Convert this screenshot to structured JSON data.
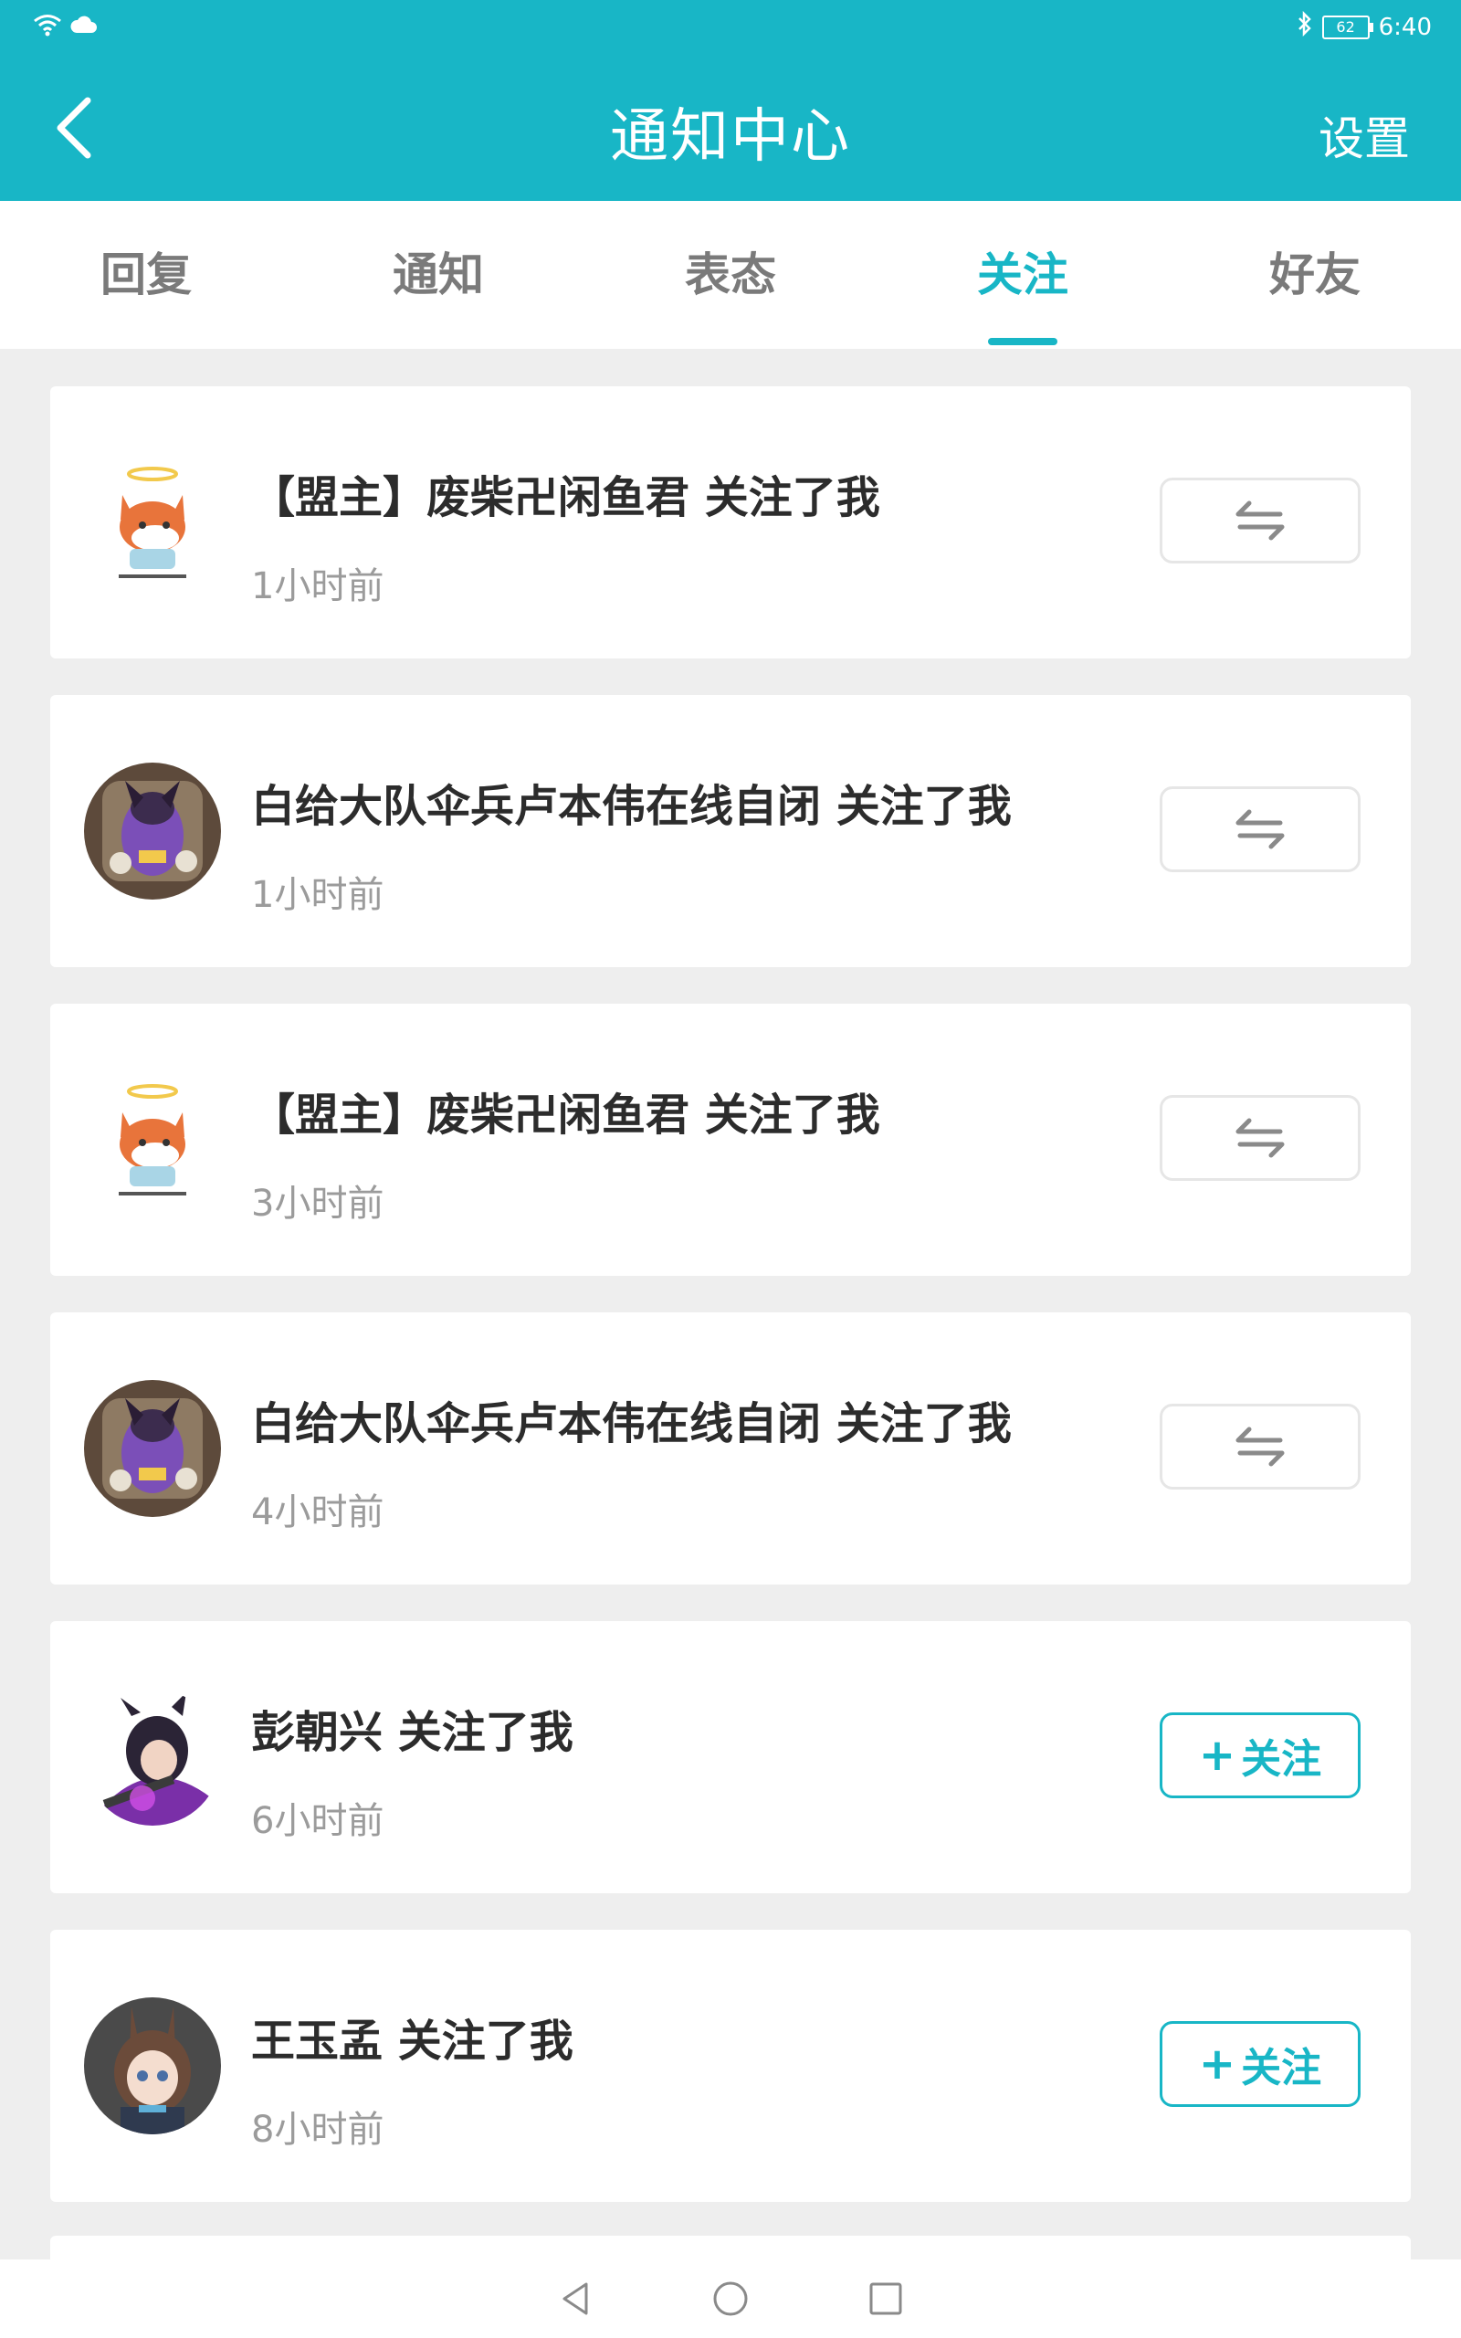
{
  "status_bar": {
    "time": "6:40",
    "battery": "62",
    "icons": [
      "wifi-icon",
      "cloud-icon",
      "bluetooth-icon",
      "battery-icon"
    ]
  },
  "header": {
    "title": "通知中心",
    "settings_label": "设置",
    "back_icon": "chevron-left-icon"
  },
  "tabs": [
    {
      "label": "回复",
      "active": false
    },
    {
      "label": "通知",
      "active": false
    },
    {
      "label": "表态",
      "active": false
    },
    {
      "label": "关注",
      "active": true
    },
    {
      "label": "好友",
      "active": false
    }
  ],
  "notifications": [
    {
      "title": "【盟主】废柴卍闲鱼君 关注了我",
      "time": "1小时前",
      "action": "mutual",
      "avatar": "fox-avatar"
    },
    {
      "title": "白给大队伞兵卢本伟在线自闭 关注了我",
      "time": "1小时前",
      "action": "mutual",
      "avatar": "purple-character-avatar"
    },
    {
      "title": "【盟主】废柴卍闲鱼君 关注了我",
      "time": "3小时前",
      "action": "mutual",
      "avatar": "fox-avatar"
    },
    {
      "title": "白给大队伞兵卢本伟在线自闭 关注了我",
      "time": "4小时前",
      "action": "mutual",
      "avatar": "purple-character-avatar"
    },
    {
      "title": "彭朝兴 关注了我",
      "time": "6小时前",
      "action": "follow",
      "action_label": "关注",
      "avatar": "anime-girl-avatar"
    },
    {
      "title": "王玉孟 关注了我",
      "time": "8小时前",
      "action": "follow",
      "action_label": "关注",
      "avatar": "bunny-girl-avatar"
    }
  ],
  "colors": {
    "accent": "#18b6c6",
    "background": "#eeeeee",
    "card": "#ffffff",
    "text_primary": "#2c2c2c",
    "text_secondary": "#9b9b9b"
  },
  "nav": [
    "back-triangle-icon",
    "home-circle-icon",
    "recents-square-icon"
  ]
}
